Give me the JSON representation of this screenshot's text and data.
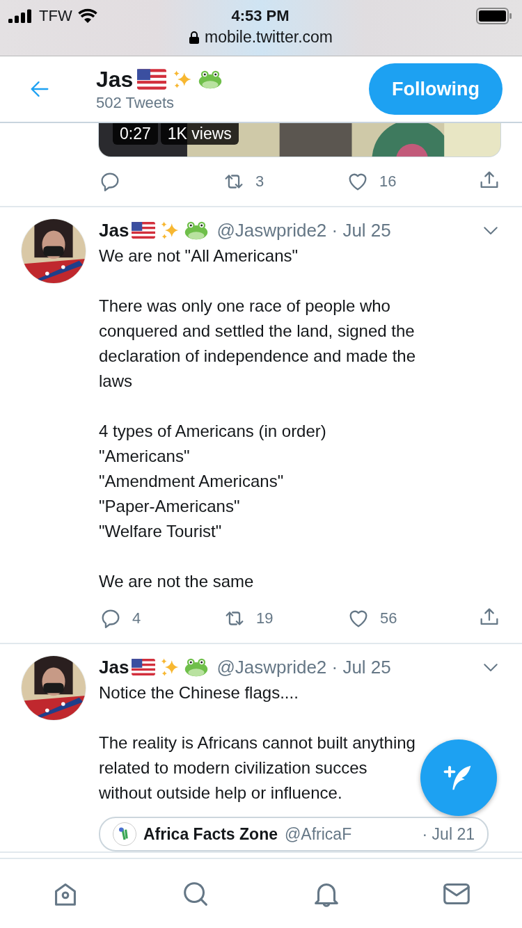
{
  "status_bar": {
    "carrier": "TFW",
    "time": "4:53 PM",
    "url": "mobile.twitter.com"
  },
  "header": {
    "name": "Jas",
    "tweet_count": "502 Tweets",
    "follow_button": "Following"
  },
  "tweets": [
    {
      "kind": "media",
      "video": {
        "duration": "0:27",
        "views": "1K views"
      },
      "actions": {
        "retweets": "3",
        "likes": "16"
      }
    },
    {
      "kind": "text",
      "name": "Jas",
      "meta": "@Jaswpride2 · Jul 25",
      "paragraphs": [
        "We are not \"All Americans\"",
        "There was only one race of people who\nconquered and settled the land, signed the\ndeclaration of independence and made the\nlaws",
        "4 types of Americans (in order)\n\"Americans\"\n\"Amendment Americans\"\n\"Paper-Americans\"\n\"Welfare Tourist\"",
        "We are not the same"
      ],
      "actions": {
        "replies": "4",
        "retweets": "19",
        "likes": "56"
      }
    },
    {
      "kind": "quote",
      "name": "Jas",
      "meta": "@Jaswpride2 · Jul 25",
      "paragraphs": [
        "Notice the Chinese flags....",
        "The reality is Africans cannot built anything\nrelated to modern civilization succes\nwithout outside help or influence."
      ],
      "quote": {
        "name": "Africa Facts Zone",
        "handle": "@AfricaF",
        "date": "· Jul 21"
      }
    }
  ]
}
